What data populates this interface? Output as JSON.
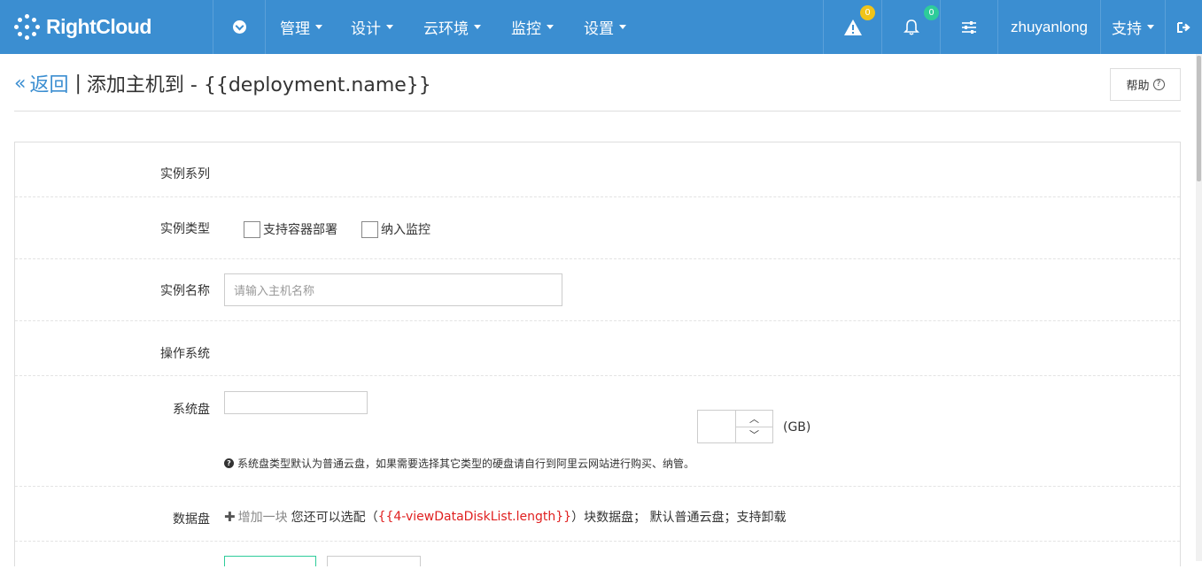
{
  "topbar": {
    "brand": "RightCloud",
    "menu": [
      {
        "label": "管理"
      },
      {
        "label": "设计"
      },
      {
        "label": "云环境"
      },
      {
        "label": "监控"
      },
      {
        "label": "设置"
      }
    ],
    "alerts_count": "0",
    "notifications_count": "0",
    "username": "zhuyanlong",
    "support_label": "支持"
  },
  "header": {
    "back_label": "返回",
    "separator": "|",
    "title": "添加主机到 - {{deployment.name}}",
    "help_label": "帮助"
  },
  "form": {
    "instance_series_label": "实例系列",
    "instance_type_label": "实例类型",
    "checkbox_container": "支持容器部署",
    "checkbox_monitor": "纳入监控",
    "instance_name_label": "实例名称",
    "instance_name_placeholder": "请输入主机名称",
    "os_label": "操作系统",
    "system_disk_label": "系统盘",
    "unit": "(GB)",
    "system_disk_note": "系统盘类型默认为普通云盘，如果需要选择其它类型的硬盘请自行到阿里云网站进行购买、纳管。",
    "data_disk_label": "数据盘",
    "add_block": "增加一块",
    "disk_text_1": "您还可以选配（",
    "disk_expr": "{{4-viewDataDiskList.length}}",
    "disk_text_2": "）块数据盘； 默认普通云盘；支持卸载"
  }
}
